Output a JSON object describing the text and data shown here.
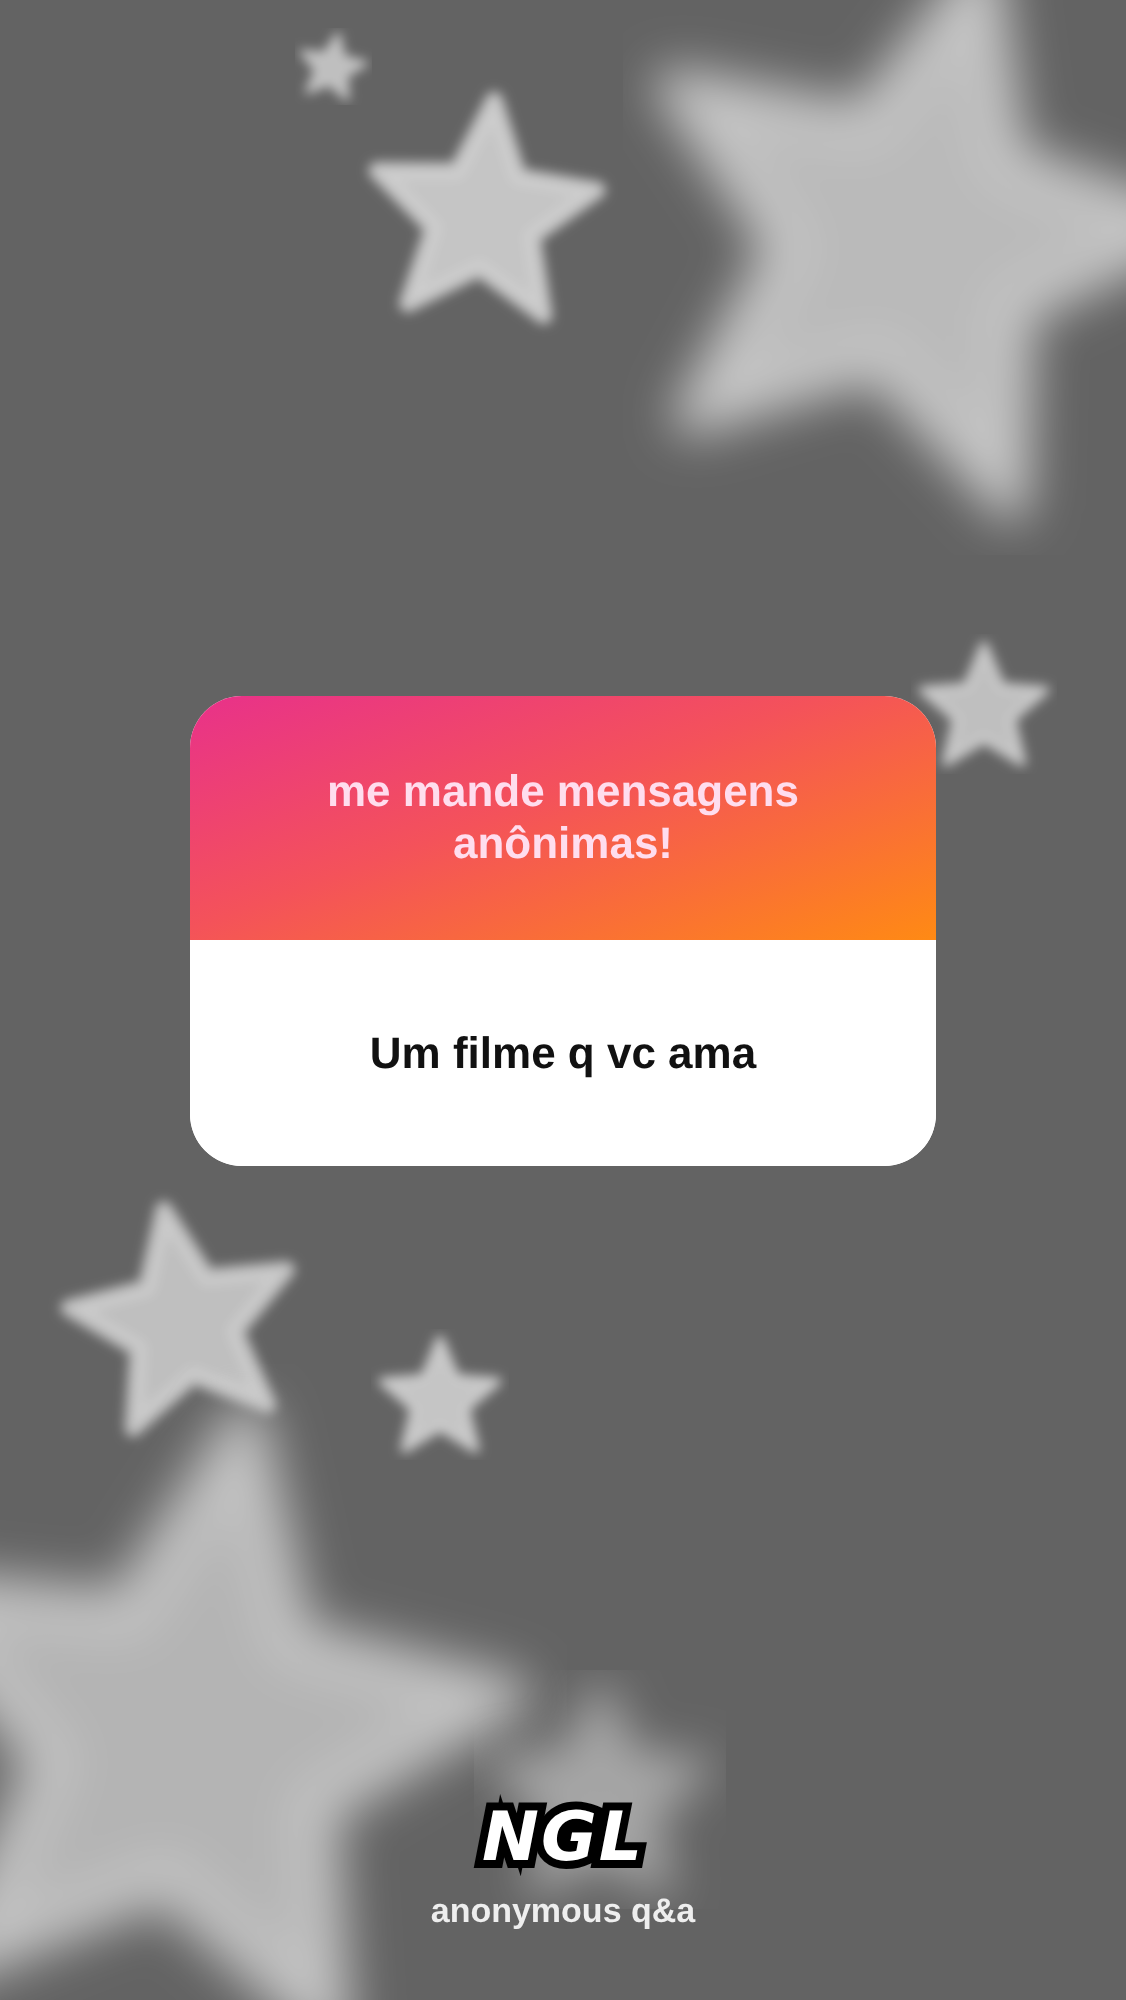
{
  "card": {
    "title": "me mande mensagens anônimas!",
    "prompt": "Um filme q vc ama"
  },
  "footer": {
    "logo": "NGL",
    "tagline": "anonymous q&a"
  }
}
